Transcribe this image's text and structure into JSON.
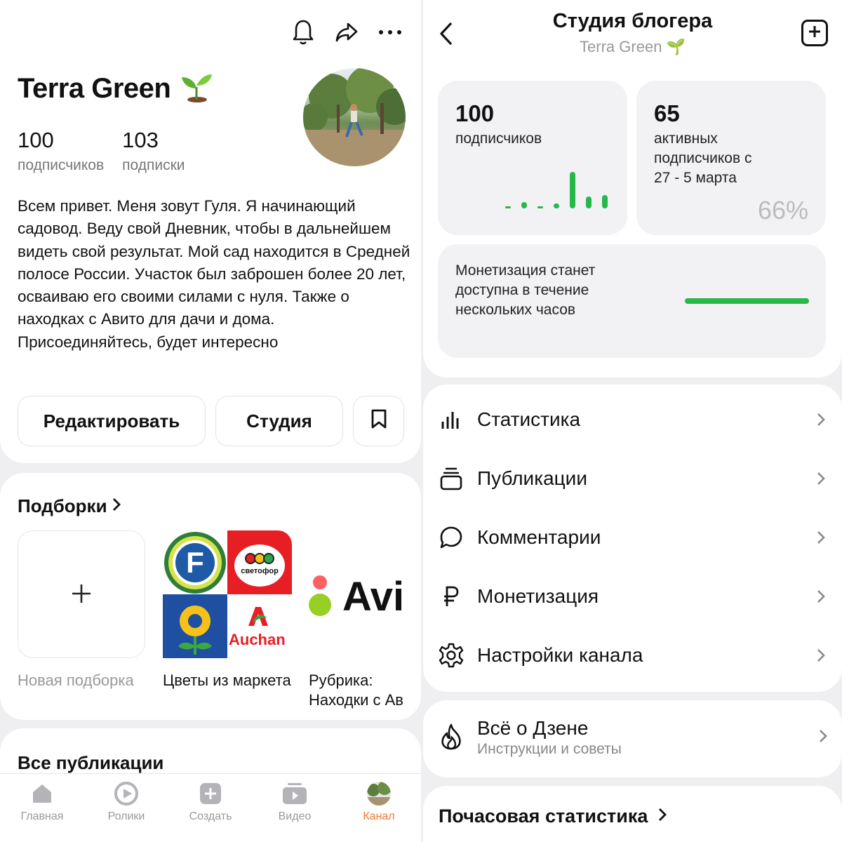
{
  "profile": {
    "name": "Terra Green",
    "name_emoji": "🌱",
    "followers_count": "100",
    "followers_label": "подписчиков",
    "following_count": "103",
    "following_label": "подписки",
    "bio": "Всем привет. Меня зовут Гуля. Я начинающий садовод. Веду свой Дневник, чтобы в дальнейшем видеть свой результат. Мой сад находится в Средней полосе России. Участок был заброшен более 20 лет, осваиваю его своими силами с нуля. Также о находках с Авито для дачи и дома. Присоединяйтесь, будет интересно",
    "edit_label": "Редактировать",
    "studio_label": "Студия",
    "top_icons": [
      "bell-icon",
      "share-icon",
      "more-icon"
    ]
  },
  "collections": {
    "title": "Подборки",
    "new_label": "Новая подборка",
    "items": [
      {
        "label": "Цветы из маркета"
      },
      {
        "label": "Рубрика: Находки с Ав"
      }
    ],
    "shop_logos": {
      "fix_price": "F",
      "svetofor": "светофор",
      "auchan": "Auchan",
      "avito": "Avi"
    }
  },
  "publications": {
    "title": "Все публикации"
  },
  "tabbar": [
    {
      "label": "Главная",
      "icon": "home-icon",
      "active": false
    },
    {
      "label": "Ролики",
      "icon": "clips-icon",
      "active": false
    },
    {
      "label": "Создать",
      "icon": "create-icon",
      "active": false
    },
    {
      "label": "Видео",
      "icon": "video-icon",
      "active": false
    },
    {
      "label": "Канал",
      "icon": "channel-avatar",
      "active": true
    }
  ],
  "studio": {
    "title": "Студия блогера",
    "subtitle": "Terra Green 🌱",
    "followers_num": "100",
    "followers_label": "подписчиков",
    "active_num": "65",
    "active_label": "активных подписчиков с 27 - 5 марта",
    "active_percent": "66%",
    "monetization_text": "Монетизация станет доступна в течение нескольких часов",
    "monetization_progress": 1.0,
    "menu": [
      {
        "label": "Статистика",
        "icon": "stats-icon"
      },
      {
        "label": "Публикации",
        "icon": "publications-icon"
      },
      {
        "label": "Комментарии",
        "icon": "comments-icon"
      },
      {
        "label": "Монетизация",
        "icon": "ruble-icon"
      },
      {
        "label": "Настройки канала",
        "icon": "settings-icon"
      }
    ],
    "zen_title": "Всё о Дзене",
    "zen_subtitle": "Инструкции и советы",
    "hourly_title": "Почасовая статистика"
  },
  "colors": {
    "accent_green": "#28b84a",
    "active_tab": "#f07a2a",
    "muted_text": "#999999"
  }
}
